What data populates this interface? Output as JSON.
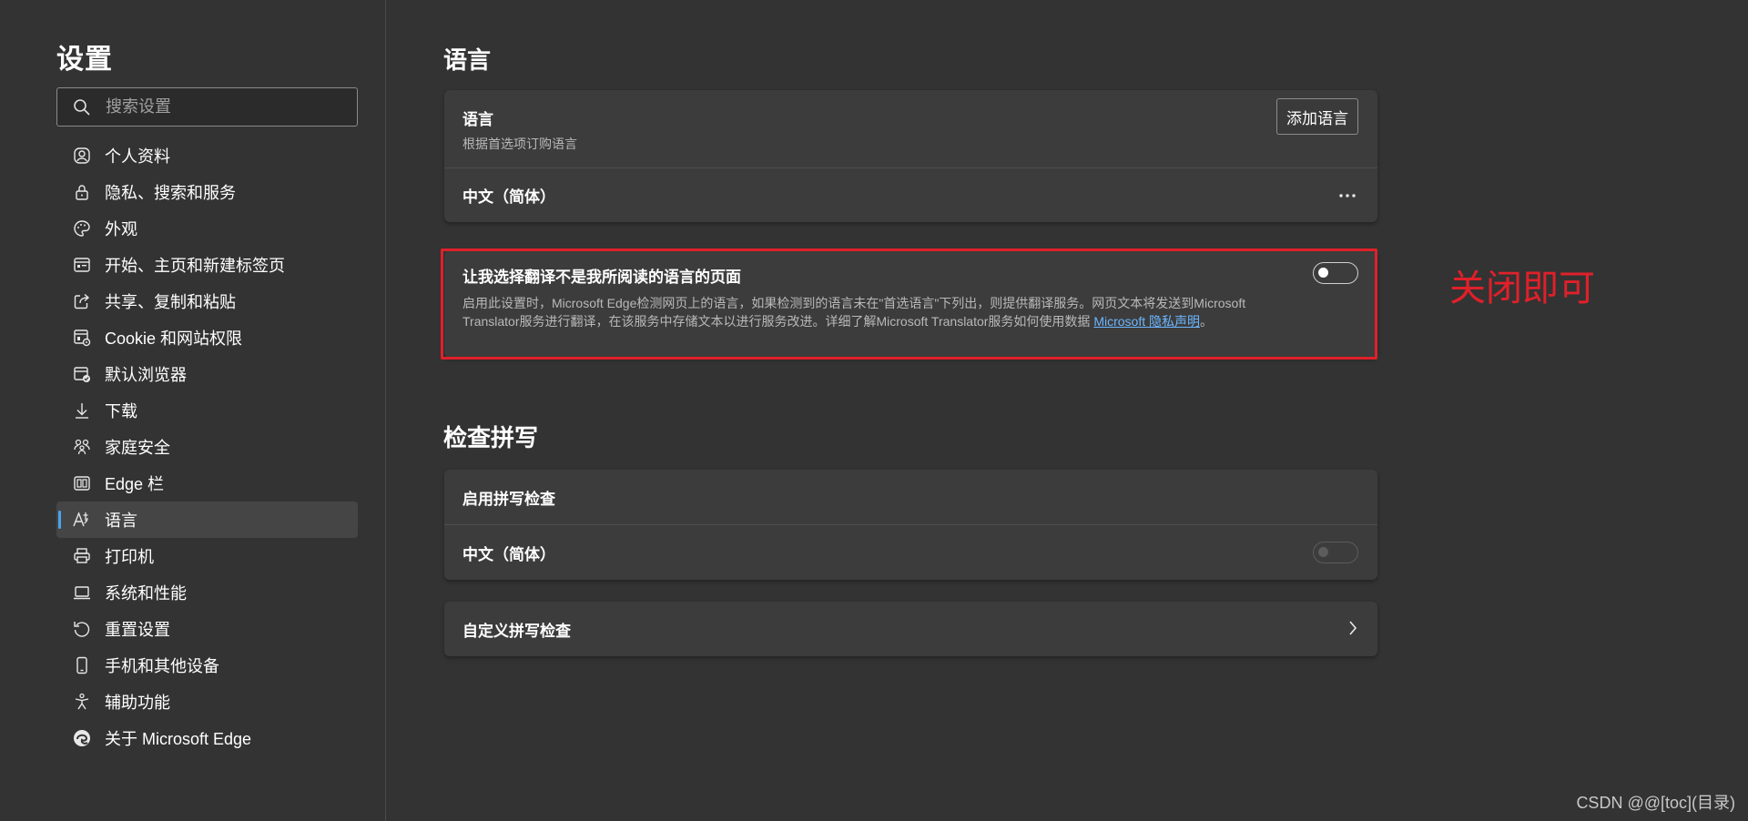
{
  "sidebar": {
    "title": "设置",
    "search_placeholder": "搜索设置",
    "items": [
      {
        "label": "个人资料",
        "icon": "profile-icon"
      },
      {
        "label": "隐私、搜索和服务",
        "icon": "lock-icon"
      },
      {
        "label": "外观",
        "icon": "palette-icon"
      },
      {
        "label": "开始、主页和新建标签页",
        "icon": "home-tab-icon"
      },
      {
        "label": "共享、复制和粘贴",
        "icon": "share-icon"
      },
      {
        "label": "Cookie 和网站权限",
        "icon": "cookie-site-permissions-icon"
      },
      {
        "label": "默认浏览器",
        "icon": "default-browser-icon"
      },
      {
        "label": "下载",
        "icon": "download-icon"
      },
      {
        "label": "家庭安全",
        "icon": "family-icon"
      },
      {
        "label": "Edge 栏",
        "icon": "edge-bar-icon"
      },
      {
        "label": "语言",
        "icon": "language-icon",
        "active": true
      },
      {
        "label": "打印机",
        "icon": "printer-icon"
      },
      {
        "label": "系统和性能",
        "icon": "laptop-icon"
      },
      {
        "label": "重置设置",
        "icon": "reset-icon"
      },
      {
        "label": "手机和其他设备",
        "icon": "phone-icon"
      },
      {
        "label": "辅助功能",
        "icon": "accessibility-icon"
      },
      {
        "label": "关于 Microsoft Edge",
        "icon": "edge-logo-icon"
      }
    ]
  },
  "language_section": {
    "title": "语言",
    "card": {
      "row_title": "语言",
      "row_subtitle": "根据首选项订购语言",
      "add_button": "添加语言",
      "language_item": "中文（简体）"
    }
  },
  "translate_card": {
    "title": "让我选择翻译不是我所阅读的语言的页面",
    "description": "启用此设置时，Microsoft Edge检测网页上的语言，如果检测到的语言未在\"首选语言\"下列出，则提供翻译服务。网页文本将发送到Microsoft Translator服务进行翻译，在该服务中存储文本以进行服务改进。详细了解Microsoft Translator服务如何使用数据 ",
    "link_text": "Microsoft 隐私声明",
    "description_end": "。",
    "toggle_on": false
  },
  "spell_section": {
    "title": "检查拼写",
    "enable_label": "启用拼写检查",
    "language_item": "中文（简体）",
    "language_toggle_on": false,
    "custom_label": "自定义拼写检查"
  },
  "annotation": "关闭即可",
  "watermark": "CSDN @@[toc](目录)",
  "colors": {
    "background": "#333333",
    "card": "#3c3c3c",
    "accent": "#4aa3f0",
    "highlight": "#e0202a",
    "link": "#6cb6ff"
  }
}
